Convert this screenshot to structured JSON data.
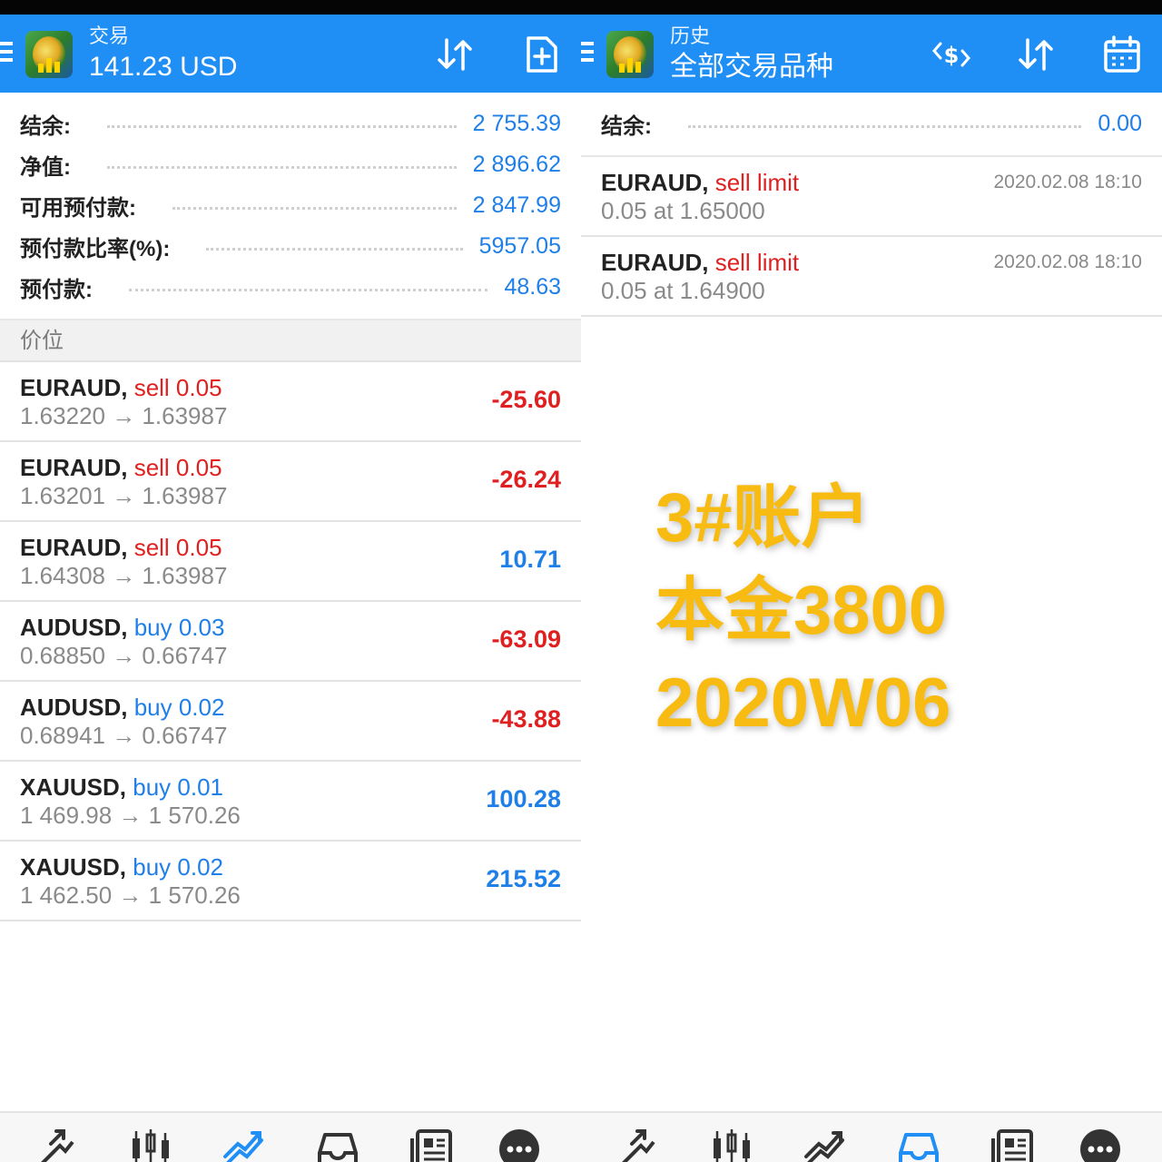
{
  "colors": {
    "accent": "#1f8ef5",
    "loss": "#e02020",
    "gain": "#1f7fe8",
    "overlay": "#f7bb12"
  },
  "left": {
    "header": {
      "subtitle": "交易",
      "title": "141.23 USD",
      "icons": [
        "sort-icon",
        "new-order-icon"
      ]
    },
    "summary": [
      {
        "label": "结余:",
        "value": "2 755.39"
      },
      {
        "label": "净值:",
        "value": "2 896.62"
      },
      {
        "label": "可用预付款:",
        "value": "2 847.99"
      },
      {
        "label": "预付款比率(%):",
        "value": "5957.05"
      },
      {
        "label": "预付款:",
        "value": "48.63"
      }
    ],
    "section_title": "价位",
    "positions": [
      {
        "symbol": "EURAUD,",
        "action": "sell 0.05",
        "prices": "1.63220 → 1.63987",
        "profit": "-25.60"
      },
      {
        "symbol": "EURAUD,",
        "action": "sell 0.05",
        "prices": "1.63201 → 1.63987",
        "profit": "-26.24"
      },
      {
        "symbol": "EURAUD,",
        "action": "sell 0.05",
        "prices": "1.64308 → 1.63987",
        "profit": "10.71"
      },
      {
        "symbol": "AUDUSD,",
        "action": "buy 0.03",
        "prices": "0.68850 → 0.66747",
        "profit": "-63.09"
      },
      {
        "symbol": "AUDUSD,",
        "action": "buy 0.02",
        "prices": "0.68941 → 0.66747",
        "profit": "-43.88"
      },
      {
        "symbol": "XAUUSD,",
        "action": "buy 0.01",
        "prices": "1 469.98 → 1 570.26",
        "profit": "100.28"
      },
      {
        "symbol": "XAUUSD,",
        "action": "buy 0.02",
        "prices": "1 462.50 → 1 570.26",
        "profit": "215.52"
      }
    ]
  },
  "right": {
    "header": {
      "subtitle": "历史",
      "title": "全部交易品种",
      "icons": [
        "currency-exchange-icon",
        "sort-icon",
        "calendar-icon"
      ]
    },
    "summary": [
      {
        "label": "结余:",
        "value": "0.00"
      }
    ],
    "orders": [
      {
        "symbol": "EURAUD,",
        "action": "sell limit",
        "detail": "0.05 at 1.65000",
        "date": "2020.02.08 18:10"
      },
      {
        "symbol": "EURAUD,",
        "action": "sell limit",
        "detail": "0.05 at 1.64900",
        "date": "2020.02.08 18:10"
      }
    ]
  },
  "overlay": {
    "lines": [
      "3#账户",
      "本金3800",
      "2020W06"
    ]
  },
  "tabbar": {
    "icons": [
      "quotes-icon",
      "chart-icon",
      "trade-icon",
      "history-icon",
      "news-icon",
      "chat-icon"
    ],
    "left_active": "trade-icon",
    "right_active": "history-icon"
  }
}
